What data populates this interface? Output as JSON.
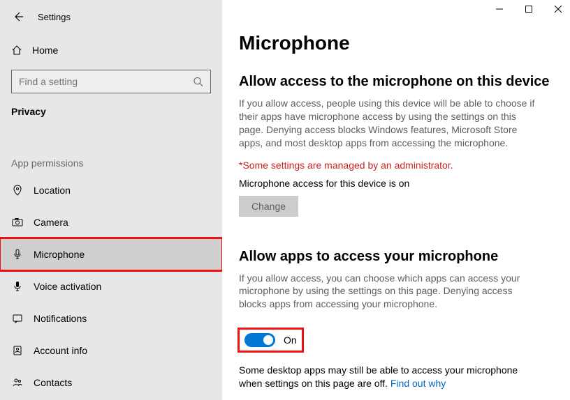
{
  "titlebar": {
    "title": "Settings"
  },
  "home": {
    "label": "Home"
  },
  "search": {
    "placeholder": "Find a setting"
  },
  "section": {
    "label": "Privacy"
  },
  "permissions": {
    "heading": "App permissions",
    "items": [
      {
        "label": "Location"
      },
      {
        "label": "Camera"
      },
      {
        "label": "Microphone"
      },
      {
        "label": "Voice activation"
      },
      {
        "label": "Notifications"
      },
      {
        "label": "Account info"
      },
      {
        "label": "Contacts"
      }
    ]
  },
  "page": {
    "title": "Microphone",
    "section1": {
      "heading": "Allow access to the microphone on this device",
      "desc": "If you allow access, people using this device will be able to choose if their apps have microphone access by using the settings on this page. Denying access blocks Windows features, Microsoft Store apps, and most desktop apps from accessing the microphone.",
      "admin_note": "*Some settings are managed by an administrator.",
      "status": "Microphone access for this device is on",
      "change_label": "Change"
    },
    "section2": {
      "heading": "Allow apps to access your microphone",
      "desc": "If you allow access, you can choose which apps can access your microphone by using the settings on this page. Denying access blocks apps from accessing your microphone.",
      "toggle_label": "On",
      "footnote_pre": "Some desktop apps may still be able to access your microphone when settings on this page are off. ",
      "footnote_link": "Find out why"
    }
  }
}
